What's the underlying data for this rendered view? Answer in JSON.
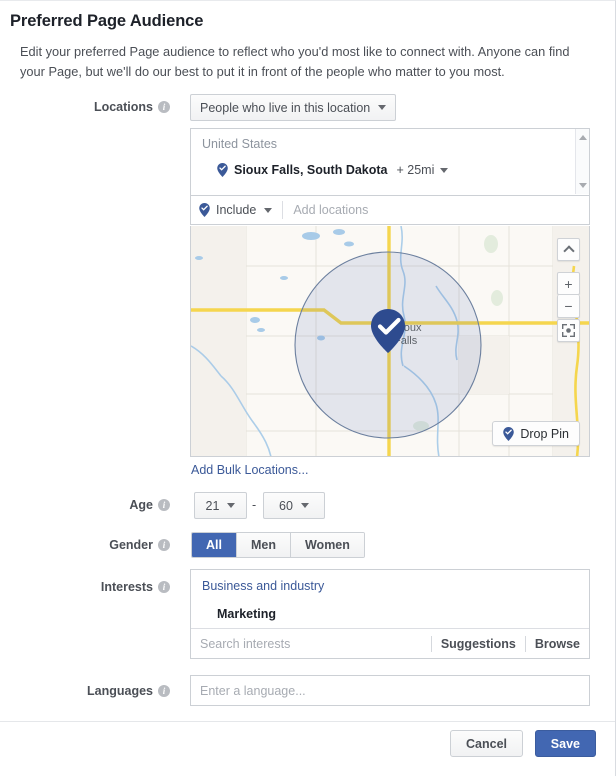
{
  "header": {
    "title": "Preferred Page Audience",
    "description": "Edit your preferred Page audience to reflect who you'd most like to connect with. Anyone can find your Page, but we'll do our best to put it in front of the people who matter to you most."
  },
  "locations": {
    "label": "Locations",
    "type_selector": "People who live in this location",
    "country": "United States",
    "selected_place": "Sioux Falls, South Dakota",
    "radius": "+ 25mi",
    "include_label": "Include",
    "add_placeholder": "Add locations",
    "bulk_link": "Add Bulk Locations...",
    "map": {
      "drop_pin_label": "Drop Pin",
      "city_label_line1": "Sioux",
      "city_label_line2": "Falls",
      "zoom_in_label": "+",
      "zoom_out_label": "−"
    }
  },
  "age": {
    "label": "Age",
    "min": "21",
    "max": "60",
    "separator": "-"
  },
  "gender": {
    "label": "Gender",
    "options": [
      "All",
      "Men",
      "Women"
    ],
    "selected": "All"
  },
  "interests": {
    "label": "Interests",
    "category": "Business and industry",
    "item": "Marketing",
    "search_placeholder": "Search interests",
    "suggestions_label": "Suggestions",
    "browse_label": "Browse"
  },
  "languages": {
    "label": "Languages",
    "placeholder": "Enter a language..."
  },
  "footer": {
    "cancel_label": "Cancel",
    "save_label": "Save"
  },
  "colors": {
    "brand_blue": "#4267b2",
    "link_blue": "#3b5998",
    "text_dark": "#1d2129",
    "text_muted": "#4b4f56",
    "placeholder": "#a7abb2",
    "border": "#ccd0d5",
    "map_road": "#f5d64e",
    "map_water": "#a8cbe8",
    "map_bg": "#fbf9f5"
  },
  "icons": {
    "info": "i"
  }
}
